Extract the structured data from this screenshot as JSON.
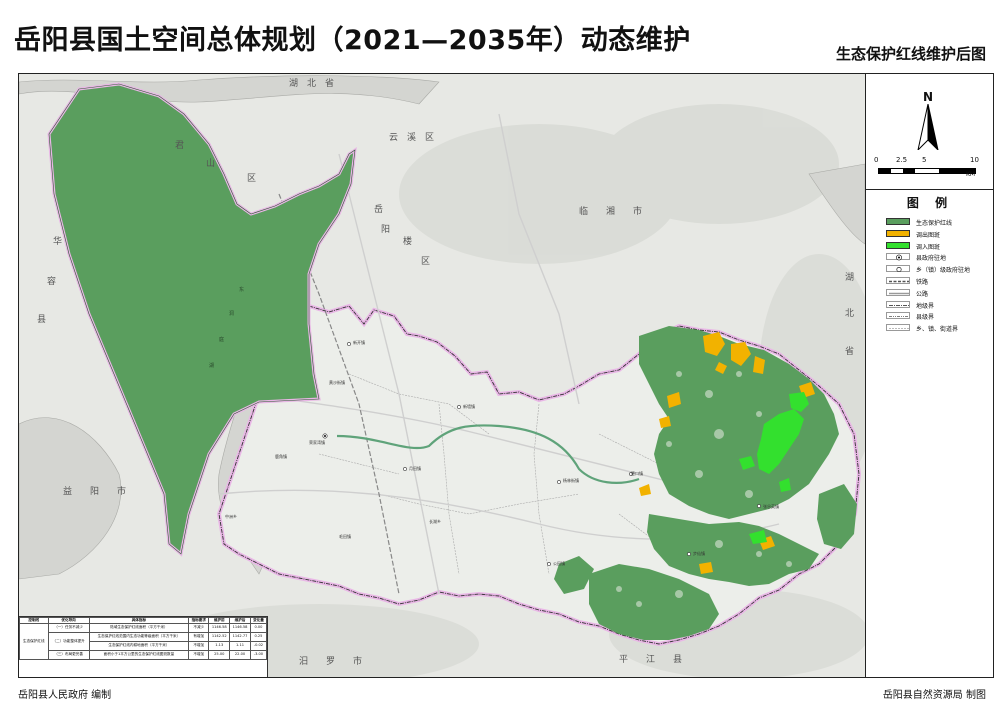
{
  "header": {
    "title": "岳阳县国土空间总体规划（2021—2035年）动态维护",
    "subtitle": "生态保护红线维护后图"
  },
  "compass": {
    "label": "N"
  },
  "scale": {
    "ticks": [
      "0",
      "2.5",
      "5",
      "10"
    ],
    "unit": "KM"
  },
  "legend": {
    "title": "图  例",
    "items": [
      {
        "label": "生态保护红线",
        "color": "#5a9e5e",
        "kind": "fill"
      },
      {
        "label": "调出图斑",
        "color": "#f2b200",
        "kind": "fill"
      },
      {
        "label": "调入图斑",
        "color": "#33e02e",
        "kind": "fill"
      },
      {
        "label": "县政府驻地",
        "kind": "symbol",
        "symbol": "circle-dot-icon"
      },
      {
        "label": "乡（镇）级政府驻地",
        "kind": "symbol",
        "symbol": "circle-icon"
      },
      {
        "label": "铁路",
        "kind": "line"
      },
      {
        "label": "公路",
        "kind": "line"
      },
      {
        "label": "地级界",
        "kind": "line-dash"
      },
      {
        "label": "县级界",
        "kind": "line-dash"
      },
      {
        "label": "乡、镇、街道界",
        "kind": "line-dash"
      }
    ]
  },
  "places": [
    {
      "text": "湖　北　省",
      "id": "hubei-top"
    },
    {
      "text": "君",
      "id": "jun"
    },
    {
      "text": "山",
      "id": "shan"
    },
    {
      "text": "区",
      "id": "qu-junshan"
    },
    {
      "text": "云　溪　区",
      "id": "yunxi"
    },
    {
      "text": "岳",
      "id": "yue"
    },
    {
      "text": "阳",
      "id": "yang"
    },
    {
      "text": "楼",
      "id": "lou"
    },
    {
      "text": "区",
      "id": "qu-yueyanglou"
    },
    {
      "text": "临　　湘　　市",
      "id": "linxiang"
    },
    {
      "text": "华",
      "id": "hua"
    },
    {
      "text": "容",
      "id": "rong"
    },
    {
      "text": "县",
      "id": "xian-huarong"
    },
    {
      "text": "益　　阳　　市",
      "id": "yiyang"
    },
    {
      "text": "湖",
      "id": "hu-right"
    },
    {
      "text": "北",
      "id": "bei-right"
    },
    {
      "text": "省",
      "id": "sheng-right"
    },
    {
      "text": "汨　　罗　　市",
      "id": "miluo"
    },
    {
      "text": "平　　江　　县",
      "id": "pingjiang"
    },
    {
      "text": "东",
      "id": "dong"
    },
    {
      "text": "洞",
      "id": "dongting"
    },
    {
      "text": "庭",
      "id": "ting"
    },
    {
      "text": "湖",
      "id": "hu-lake"
    }
  ],
  "towns": [
    "新开镇",
    "新墙镇",
    "荣家湾镇",
    "黄沙街镇",
    "鹿角镇",
    "月田镇",
    "张谷英镇",
    "杨林街镇",
    "中洲乡",
    "长湖乡",
    "筻口镇",
    "公田镇",
    "步仙镇",
    "毛田镇"
  ],
  "table": {
    "headers": [
      "控制线",
      "优化导向",
      "具体指标",
      "指标要求",
      "维护前",
      "维护后",
      "变化量"
    ],
    "group": "生态保护红线",
    "rows": [
      [
        "（一）任务不减少",
        "陆域生态保护红线面积（平方千米）",
        "不减少",
        "1146.58",
        "1146.58",
        "0.00"
      ],
      [
        "（二）功能整体提升",
        "生态保护红线范围内生态功能等级面积（平方千米）",
        "有增加",
        "1142.52",
        "1142.77",
        "0.25"
      ],
      [
        "",
        "生态保护红线内耕地面积（平方千米）",
        "不增加",
        "1.13",
        "1.11",
        "-0.02"
      ],
      [
        "（三）布局更完善",
        "面积小于1平方公里的生态保护红线图斑数量",
        "不增加",
        "25.00",
        "22.00",
        "-3.00"
      ]
    ]
  },
  "footer": {
    "left": "岳阳县人民政府 编制",
    "right": "岳阳县自然资源局 制图"
  }
}
